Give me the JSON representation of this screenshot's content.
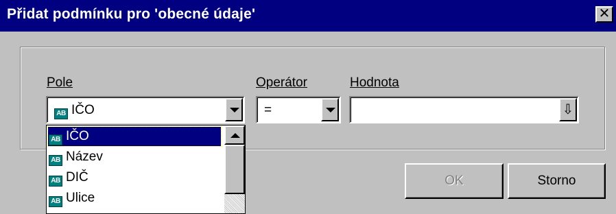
{
  "window": {
    "title": "Přidat podmínku pro 'obecné údaje'",
    "close_label": "✕"
  },
  "labels": {
    "field": "Pole",
    "operator": "Operátor",
    "value": "Hodnota"
  },
  "field_combo": {
    "icon_text": "AB",
    "selected": "IČO"
  },
  "operator_combo": {
    "selected": "="
  },
  "value_combo": {
    "value": "",
    "button_icon": "⇩"
  },
  "field_list": {
    "items": [
      {
        "icon_text": "AB",
        "label": "IČO",
        "selected": true
      },
      {
        "icon_text": "AB",
        "label": "Název",
        "selected": false
      },
      {
        "icon_text": "AB",
        "label": "DIČ",
        "selected": false
      },
      {
        "icon_text": "AB",
        "label": "Ulice",
        "selected": false
      }
    ]
  },
  "buttons": {
    "ok_label": "OK",
    "ok_enabled": false,
    "cancel_label": "Storno"
  },
  "colors": {
    "titlebar": "#000080",
    "face": "#c0c0c0",
    "selection": "#000080",
    "icon": "#008080"
  }
}
